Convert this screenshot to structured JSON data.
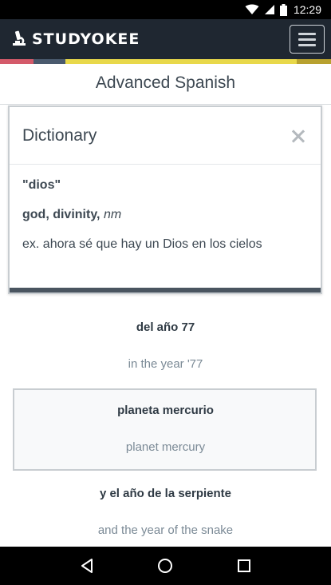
{
  "status_bar": {
    "time": "12:29"
  },
  "header": {
    "brand": "STUDYOKEE"
  },
  "stripe_colors": [
    "#d45a6a",
    "#4a5a6e",
    "#e8d84a",
    "#b8a12f"
  ],
  "course": {
    "title": "Advanced Spanish"
  },
  "dictionary": {
    "title": "Dictionary",
    "term": "\"dios\"",
    "definition": "god, divinity,",
    "part_of_speech": "nm",
    "example": "ex. ahora sé que hay un Dios en los cielos"
  },
  "lines": [
    {
      "source": "del año 77",
      "translation": "in the year '77"
    },
    {
      "source": "planeta mercurio",
      "translation": "planet mercury"
    },
    {
      "source": "y el año de la serpiente",
      "translation": "and the year of the snake"
    }
  ],
  "icons": {
    "wifi": "wifi-icon",
    "signal": "signal-icon",
    "battery": "battery-icon",
    "menu": "hamburger-menu-icon",
    "close": "close-icon",
    "back": "back-icon",
    "home": "home-icon",
    "recents": "recents-icon"
  }
}
